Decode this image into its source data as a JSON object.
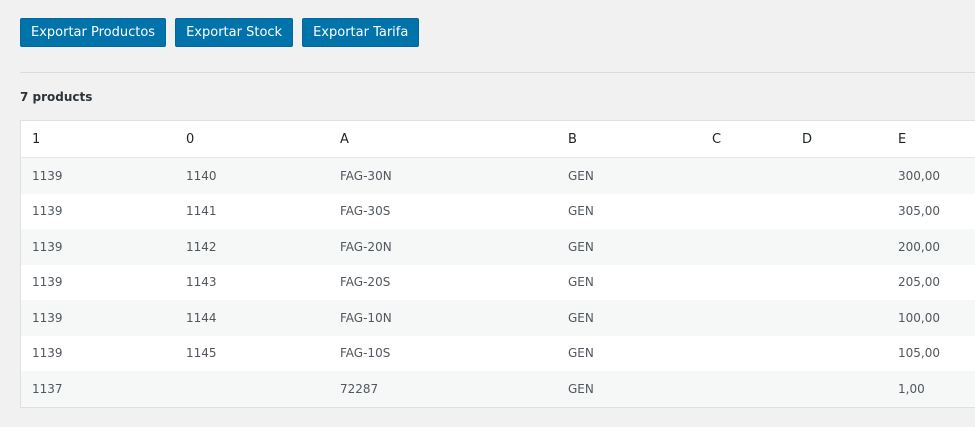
{
  "toolbar": {
    "export_products_label": "Exportar Productos",
    "export_stock_label": "Exportar Stock",
    "export_tariff_label": "Exportar Tarifa"
  },
  "product_count": "7 products",
  "table": {
    "headers": [
      "1",
      "0",
      "A",
      "B",
      "C",
      "D",
      "E"
    ],
    "rows": [
      [
        "1139",
        "1140",
        "FAG-30N",
        "GEN",
        "",
        "",
        "300,00"
      ],
      [
        "1139",
        "1141",
        "FAG-30S",
        "GEN",
        "",
        "",
        "305,00"
      ],
      [
        "1139",
        "1142",
        "FAG-20N",
        "GEN",
        "",
        "",
        "200,00"
      ],
      [
        "1139",
        "1143",
        "FAG-20S",
        "GEN",
        "",
        "",
        "205,00"
      ],
      [
        "1139",
        "1144",
        "FAG-10N",
        "GEN",
        "",
        "",
        "100,00"
      ],
      [
        "1139",
        "1145",
        "FAG-10S",
        "GEN",
        "",
        "",
        "105,00"
      ],
      [
        "1137",
        "",
        "72287",
        "GEN",
        "",
        "",
        "1,00"
      ]
    ]
  },
  "colors": {
    "button_bg": "#0073aa",
    "page_bg": "#f1f1f1"
  }
}
